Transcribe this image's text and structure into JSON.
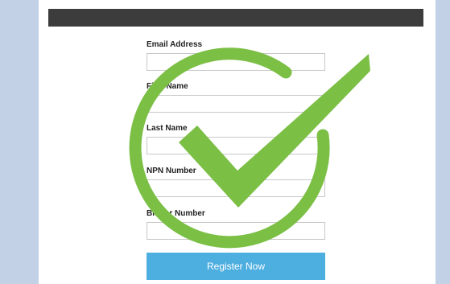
{
  "form": {
    "fields": [
      {
        "label": "Email Address",
        "value": "",
        "placeholder": ""
      },
      {
        "label": "First Name",
        "value": "",
        "placeholder": ""
      },
      {
        "label": "Last Name",
        "value": "",
        "placeholder": ""
      },
      {
        "label": "NPN Number",
        "value": "",
        "placeholder": ""
      },
      {
        "label": "Broker Number",
        "value": "",
        "placeholder": ""
      }
    ],
    "submit_label": "Register Now"
  },
  "colors": {
    "accent_button": "#4daee0",
    "header_bar": "#3c3c3c",
    "checkmark": "#7bbf45",
    "backdrop": "#c3d1e6"
  },
  "icons": {
    "overlay": "checkmark-circle-icon"
  }
}
